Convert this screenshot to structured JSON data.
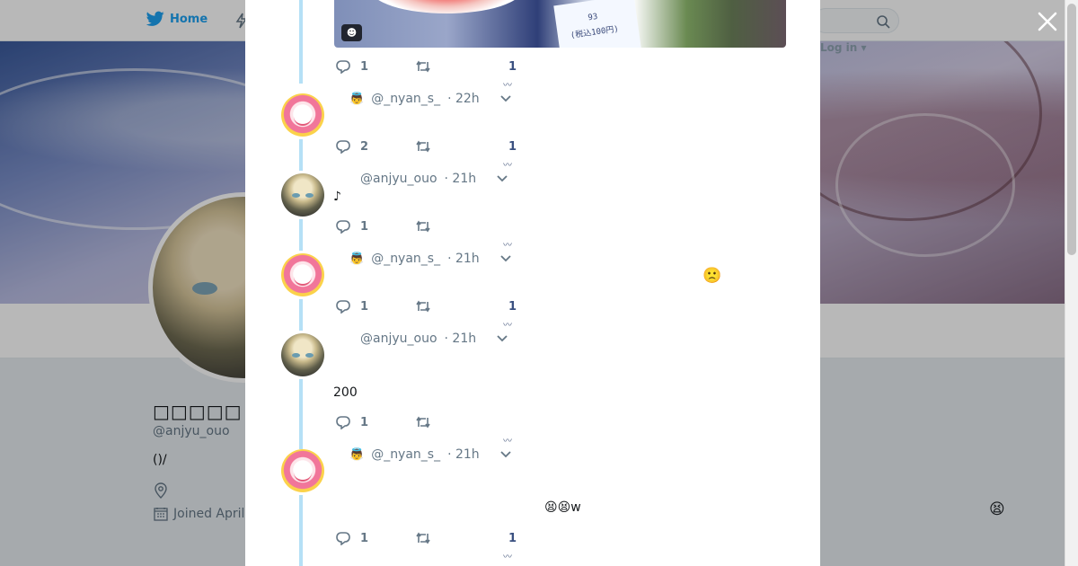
{
  "nav": {
    "home_label": "Home",
    "login_label": "Log in"
  },
  "profile": {
    "display_name": "□□□□□",
    "handle": "@anjyu_ouo",
    "bio": "()/",
    "joined": "Joined April"
  },
  "colors": {
    "accent": "#1da1f2",
    "thread_line": "#b5e0f6",
    "muted": "#657786"
  },
  "media": {
    "label_line1": "93",
    "label_line2": "(税込100円)",
    "badge": "☻"
  },
  "thread": [
    {
      "id": "t0",
      "actions": {
        "reply_count": "1",
        "retweet_count": "",
        "like_count": "1"
      }
    },
    {
      "id": "t1",
      "author_badge": "👼",
      "handle": "@_nyan_s_",
      "time": "· 22h",
      "text": "",
      "actions": {
        "reply_count": "2",
        "retweet_count": "",
        "like_count": "1"
      }
    },
    {
      "id": "t2",
      "author_badge": "",
      "handle": "@anjyu_ouo",
      "time": "· 21h",
      "text": "♪",
      "actions": {
        "reply_count": "1",
        "retweet_count": "",
        "like_count": ""
      }
    },
    {
      "id": "t3",
      "author_badge": "👼",
      "handle": "@_nyan_s_",
      "time": "· 21h",
      "text": "🙁",
      "actions": {
        "reply_count": "1",
        "retweet_count": "",
        "like_count": "1"
      }
    },
    {
      "id": "t4",
      "author_badge": "",
      "handle": "@anjyu_ouo",
      "time": "· 21h",
      "text": "200",
      "actions": {
        "reply_count": "1",
        "retweet_count": "",
        "like_count": ""
      }
    },
    {
      "id": "t5",
      "author_badge": "👼",
      "handle": "@_nyan_s_",
      "time": "· 21h",
      "text": "😫😫w",
      "actions": {
        "reply_count": "1",
        "retweet_count": "",
        "like_count": "1"
      }
    }
  ],
  "floating_emoji": "😫"
}
